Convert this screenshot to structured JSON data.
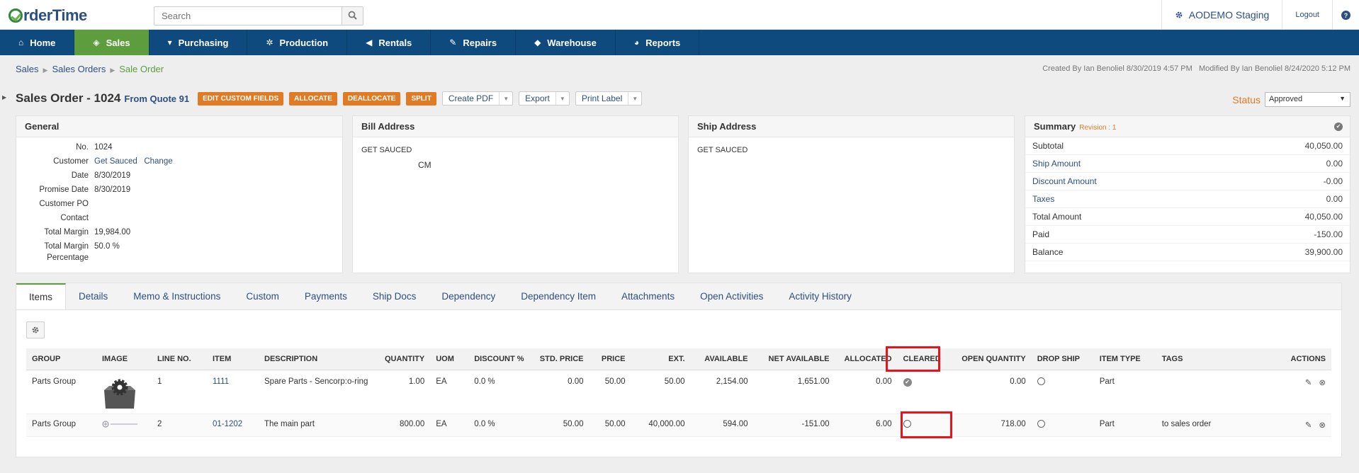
{
  "brand": {
    "logo_text": "rderTime"
  },
  "search": {
    "placeholder": "Search"
  },
  "top_right": {
    "company": "AODEMO Staging",
    "logout": "Logout"
  },
  "nav": [
    {
      "label": "Home",
      "icon": "home-icon"
    },
    {
      "label": "Sales",
      "icon": "tag-icon",
      "active": true
    },
    {
      "label": "Purchasing",
      "icon": "cart-icon"
    },
    {
      "label": "Production",
      "icon": "gears-icon"
    },
    {
      "label": "Rentals",
      "icon": "bullhorn-icon"
    },
    {
      "label": "Repairs",
      "icon": "wrench-icon"
    },
    {
      "label": "Warehouse",
      "icon": "cube-icon"
    },
    {
      "label": "Reports",
      "icon": "pie-chart-icon"
    }
  ],
  "breadcrumb": {
    "items": [
      "Sales",
      "Sales Orders"
    ],
    "current": "Sale Order"
  },
  "meta": {
    "text": "Created By Ian Benoliel 8/30/2019 4:57 PM   Modified By Ian Benoliel 8/24/2020 5:12 PM"
  },
  "title": {
    "main": "Sales Order - 1024",
    "quote_link": "From Quote 91",
    "orange_buttons": [
      "EDIT CUSTOM FIELDS",
      "ALLOCATE",
      "DEALLOCATE",
      "SPLIT"
    ],
    "split_buttons": [
      "Create PDF",
      "Export",
      "Print Label"
    ]
  },
  "status": {
    "label": "Status",
    "value": "Approved"
  },
  "general": {
    "title": "General",
    "rows": [
      {
        "k": "No.",
        "v": "1024"
      },
      {
        "k": "Customer",
        "v": "Get Sauced",
        "extra": "Change"
      },
      {
        "k": "Date",
        "v": "8/30/2019"
      },
      {
        "k": "Promise Date",
        "v": "8/30/2019"
      },
      {
        "k": "Customer PO",
        "v": ""
      },
      {
        "k": "Contact",
        "v": ""
      },
      {
        "k": "Total Margin",
        "v": "19,984.00"
      },
      {
        "k": "Total Margin Percentage",
        "v": "50.0 %"
      }
    ]
  },
  "bill": {
    "title": "Bill Address",
    "line1": "GET SAUCED",
    "line2": "CM"
  },
  "ship": {
    "title": "Ship Address",
    "line1": "GET SAUCED"
  },
  "summary": {
    "title": "Summary",
    "revision": "Revision : 1",
    "rows": [
      {
        "k": "Subtotal",
        "v": "40,050.00",
        "link": false
      },
      {
        "k": "Ship Amount",
        "v": "0.00",
        "link": true
      },
      {
        "k": "Discount Amount",
        "v": "-0.00",
        "link": true
      },
      {
        "k": "Taxes",
        "v": "0.00",
        "link": true
      },
      {
        "k": "Total Amount",
        "v": "40,050.00",
        "link": false
      },
      {
        "k": "Paid",
        "v": "-150.00",
        "link": false
      },
      {
        "k": "Balance",
        "v": "39,900.00",
        "link": false
      }
    ]
  },
  "tabs": [
    "Items",
    "Details",
    "Memo & Instructions",
    "Custom",
    "Payments",
    "Ship Docs",
    "Dependency",
    "Dependency Item",
    "Attachments",
    "Open Activities",
    "Activity History"
  ],
  "table": {
    "headers": [
      "GROUP",
      "IMAGE",
      "LINE NO.",
      "ITEM",
      "DESCRIPTION",
      "QUANTITY",
      "UOM",
      "DISCOUNT %",
      "STD. PRICE",
      "PRICE",
      "EXT.",
      "AVAILABLE",
      "NET AVAILABLE",
      "ALLOCATED",
      "CLEARED",
      "OPEN QUANTITY",
      "DROP SHIP",
      "ITEM TYPE",
      "TAGS",
      "ACTIONS"
    ],
    "rows": [
      {
        "group": "Parts Group",
        "line": "1",
        "item": "1111",
        "description": "Spare Parts - Sencorp:o-ring",
        "quantity": "1.00",
        "uom": "EA",
        "discount": "0.0 %",
        "std_price": "0.00",
        "price": "50.00",
        "ext": "50.00",
        "available": "2,154.00",
        "net_available": "1,651.00",
        "allocated": "0.00",
        "cleared": true,
        "open_quantity": "0.00",
        "item_type": "Part",
        "tags": ""
      },
      {
        "group": "Parts Group",
        "line": "2",
        "item": "01-1202",
        "description": "The main part",
        "quantity": "800.00",
        "uom": "EA",
        "discount": "0.0 %",
        "std_price": "50.00",
        "price": "50.00",
        "ext": "40,000.00",
        "available": "594.00",
        "net_available": "-151.00",
        "allocated": "6.00",
        "cleared": false,
        "open_quantity": "718.00",
        "item_type": "Part",
        "tags": "to sales order"
      }
    ]
  },
  "colors": {
    "nav_bg": "#0e4a7e",
    "active_nav": "#5d9d3e",
    "orange": "#e07b24",
    "link": "#2c4f82",
    "highlight": "#e8141c"
  }
}
